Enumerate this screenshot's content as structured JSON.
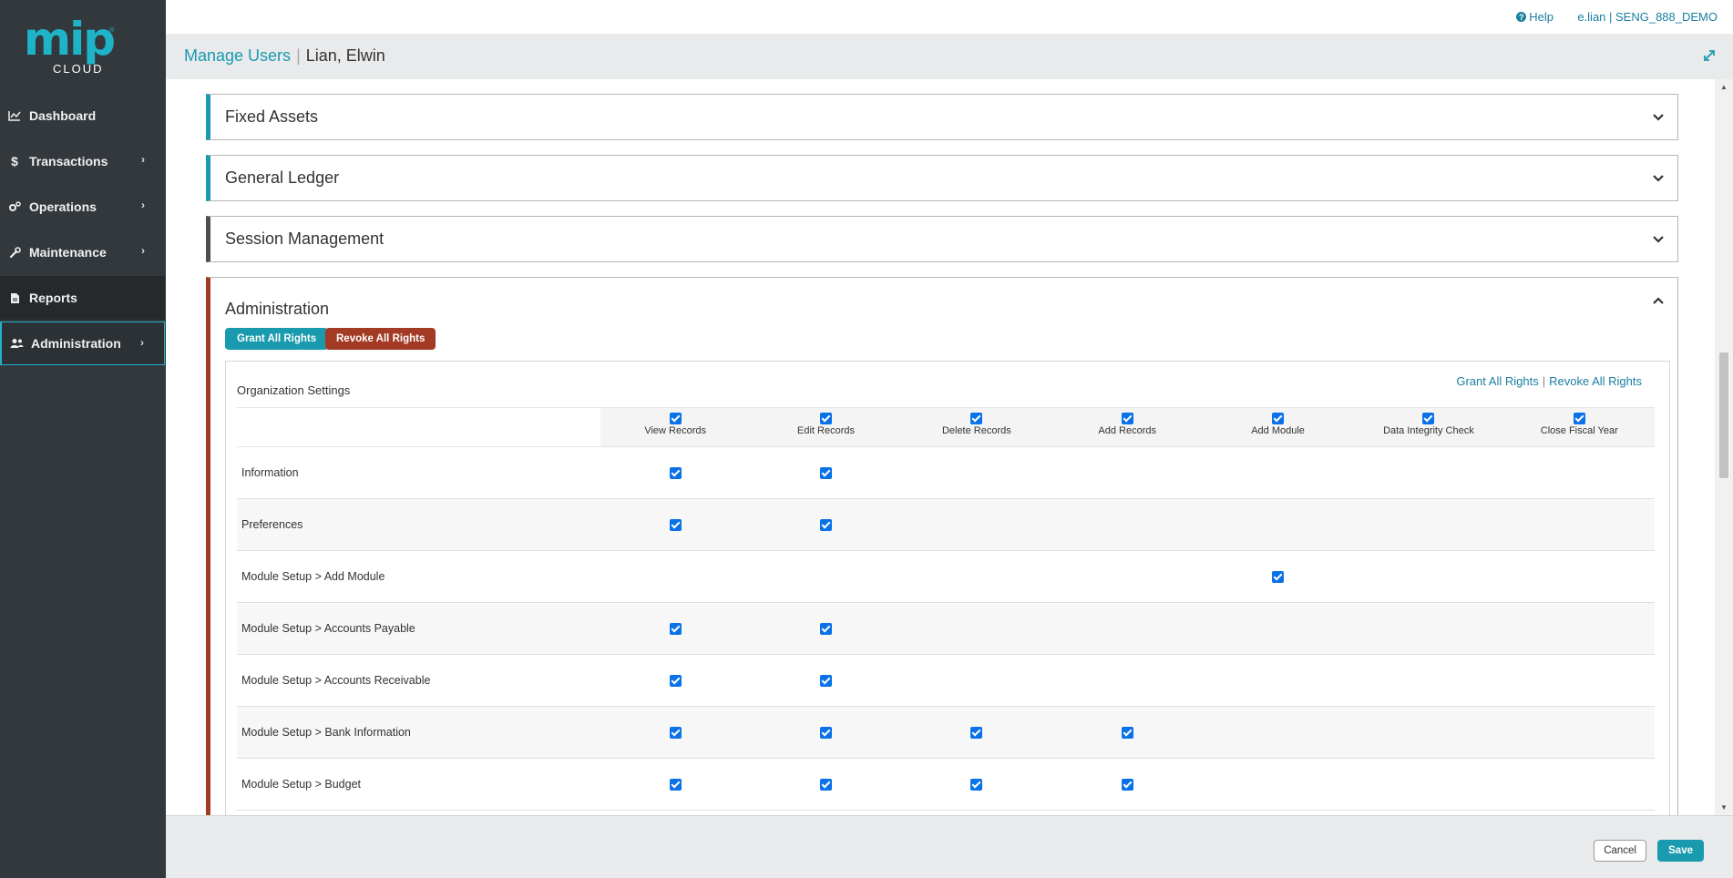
{
  "brand": {
    "logo_main": "mip",
    "logo_sub": "CLOUD"
  },
  "topbar": {
    "help_label": "Help",
    "user_info": "e.lian | SENG_888_DEMO"
  },
  "header": {
    "breadcrumb_parent": "Manage Users",
    "breadcrumb_separator": "|",
    "breadcrumb_current": "Lian, Elwin"
  },
  "sidebar": {
    "items": [
      {
        "label": "Dashboard",
        "icon": "chart-line-icon"
      },
      {
        "label": "Transactions",
        "icon": "dollar-icon"
      },
      {
        "label": "Operations",
        "icon": "gears-icon"
      },
      {
        "label": "Maintenance",
        "icon": "wrench-icon"
      },
      {
        "label": "Reports",
        "icon": "file-icon"
      },
      {
        "label": "Administration",
        "icon": "users-icon"
      }
    ]
  },
  "panels": [
    {
      "title": "Fixed Assets"
    },
    {
      "title": "General Ledger"
    },
    {
      "title": "Session Management"
    }
  ],
  "admin": {
    "title": "Administration",
    "grant_all": "Grant All Rights",
    "revoke_all": "Revoke All Rights",
    "org": {
      "title": "Organization Settings",
      "link_grant": "Grant All Rights",
      "link_separator": "|",
      "link_revoke": "Revoke All Rights",
      "columns": [
        "View Records",
        "Edit Records",
        "Delete Records",
        "Add Records",
        "Add Module",
        "Data Integrity Check",
        "Close Fiscal Year"
      ],
      "rows": [
        {
          "label": "Information",
          "checks": [
            true,
            true,
            false,
            false,
            false,
            false,
            false
          ]
        },
        {
          "label": "Preferences",
          "checks": [
            true,
            true,
            false,
            false,
            false,
            false,
            false
          ]
        },
        {
          "label": "Module Setup > Add Module",
          "checks": [
            false,
            false,
            false,
            false,
            true,
            false,
            false
          ]
        },
        {
          "label": "Module Setup > Accounts Payable",
          "checks": [
            true,
            true,
            false,
            false,
            false,
            false,
            false
          ]
        },
        {
          "label": "Module Setup > Accounts Receivable",
          "checks": [
            true,
            true,
            false,
            false,
            false,
            false,
            false
          ]
        },
        {
          "label": "Module Setup > Bank Information",
          "checks": [
            true,
            true,
            true,
            true,
            false,
            false,
            false
          ]
        },
        {
          "label": "Module Setup > Budget",
          "checks": [
            true,
            true,
            true,
            true,
            false,
            false,
            false
          ]
        }
      ]
    }
  },
  "footer": {
    "cancel_label": "Cancel",
    "save_label": "Save"
  },
  "colors": {
    "accent": "#1a9aae",
    "danger": "#a33a23",
    "sidebar_bg": "#33383d",
    "checkbox": "#0a72e8"
  }
}
